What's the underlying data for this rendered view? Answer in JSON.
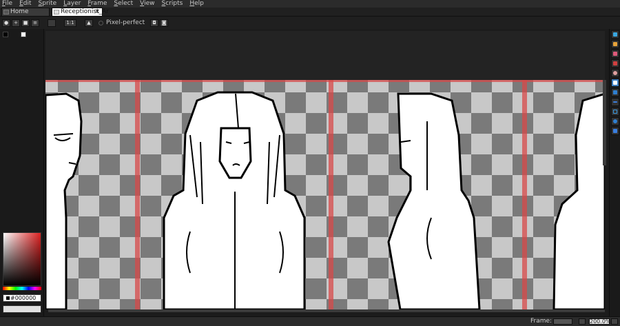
{
  "menu": [
    {
      "label": "File",
      "u": "F",
      "rest": "ile"
    },
    {
      "label": "Edit",
      "u": "E",
      "rest": "dit"
    },
    {
      "label": "Sprite",
      "u": "S",
      "rest": "prite"
    },
    {
      "label": "Layer",
      "u": "L",
      "rest": "ayer"
    },
    {
      "label": "Frame",
      "u": "F",
      "rest": "rame"
    },
    {
      "label": "Select",
      "u": "S",
      "rest": "elect"
    },
    {
      "label": "View",
      "u": "V",
      "rest": "iew"
    },
    {
      "label": "Scripts",
      "u": "S",
      "rest": "cripts"
    },
    {
      "label": "Help",
      "u": "H",
      "rest": "elp"
    }
  ],
  "tabs": {
    "home": "Home",
    "active": "Receptionist_Ar",
    "close_glyph": "×"
  },
  "context": {
    "pixel_perfect": "Pixel-perfect",
    "scale_button": "1:1"
  },
  "colors": {
    "foreground": "#000000",
    "background": "#ffffff",
    "hex_value": "000000",
    "slice_color": "#d84a4a"
  },
  "status": {
    "frame_label": "Frame:",
    "frame_value": "1",
    "zoom": "200.0%"
  },
  "tools": [
    "marquee-icon",
    "pencil-icon",
    "eraser-icon",
    "eyedropper-icon",
    "zoom-icon",
    "move-icon",
    "bucket-icon",
    "line-icon",
    "rectangle-icon",
    "ellipse-icon",
    "contour-icon"
  ]
}
